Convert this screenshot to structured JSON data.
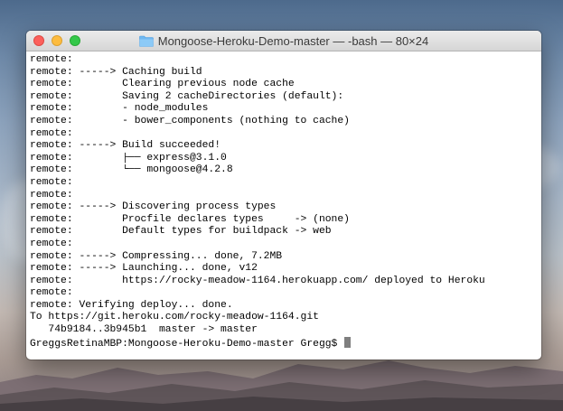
{
  "window": {
    "title": "Mongoose-Heroku-Demo-master — -bash — 80×24",
    "folder_icon": "folder-icon",
    "colors": {
      "close": "#fc605c",
      "minimize": "#fdbc40",
      "maximize": "#34c84a",
      "folder": "#6fb8f1"
    }
  },
  "terminal": {
    "lines": [
      "remote:",
      "remote: -----> Caching build",
      "remote:        Clearing previous node cache",
      "remote:        Saving 2 cacheDirectories (default):",
      "remote:        - node_modules",
      "remote:        - bower_components (nothing to cache)",
      "remote:",
      "remote: -----> Build succeeded!",
      "remote:        ├── express@3.1.0",
      "remote:        └── mongoose@4.2.8",
      "remote:",
      "remote:",
      "remote: -----> Discovering process types",
      "remote:        Procfile declares types     -> (none)",
      "remote:        Default types for buildpack -> web",
      "remote:",
      "remote: -----> Compressing... done, 7.2MB",
      "remote: -----> Launching... done, v12",
      "remote:        https://rocky-meadow-1164.herokuapp.com/ deployed to Heroku",
      "remote:",
      "remote: Verifying deploy... done.",
      "To https://git.heroku.com/rocky-meadow-1164.git",
      "   74b9184..3b945b1  master -> master"
    ],
    "prompt": "GreggsRetinaMBP:Mongoose-Heroku-Demo-master Gregg$ "
  }
}
